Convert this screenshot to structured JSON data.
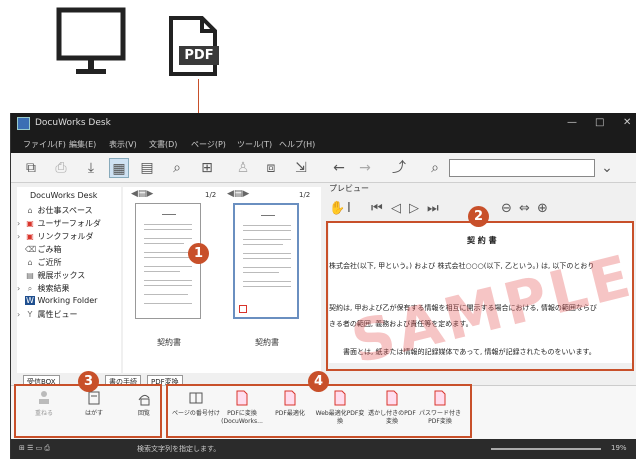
{
  "app": {
    "title": "DocuWorks Desk",
    "menu": [
      "ファイル(F)",
      "編集(E)",
      "表示(V)",
      "文書(D)",
      "ページ(P)",
      "ツール(T)",
      "ヘルプ(H)"
    ]
  },
  "pdf_badge": "PDF",
  "tree": {
    "root": "DocuWorks Desk",
    "items": [
      {
        "label": "お仕事スペース",
        "icon": "workspace-icon",
        "chevron": false
      },
      {
        "label": "ユーザーフォルダ",
        "icon": "user-folder-icon",
        "chevron": true
      },
      {
        "label": "リンクフォルダ",
        "icon": "link-folder-icon",
        "chevron": true
      },
      {
        "label": "ごみ箱",
        "icon": "trash-icon",
        "chevron": false
      },
      {
        "label": "ご近所",
        "icon": "neighborhood-icon",
        "chevron": false
      },
      {
        "label": "親展ボックス",
        "icon": "inbox-icon",
        "chevron": false
      },
      {
        "label": "検索結果",
        "icon": "search-results-icon",
        "chevron": true
      },
      {
        "label": "Working Folder",
        "icon": "working-folder-icon",
        "chevron": false
      },
      {
        "label": "属性ビュー",
        "icon": "attribute-view-icon",
        "chevron": true
      }
    ]
  },
  "thumbnails": [
    {
      "label": "契約書",
      "page": "1/2"
    },
    {
      "label": "契約書",
      "page": "1/2"
    }
  ],
  "preview": {
    "header": "プレビュー",
    "doc_title": "契 約 書",
    "watermark": "SAMPLE",
    "lines": [
      "株式会社(以下, 甲という。) および 株式会社○○○(以下, 乙という。) は, 以下のとおり",
      "契約は, 甲および乙が保有する情報を相互に開示する場合における, 情報の範囲ならび",
      "きる者の範囲, 義務および責任等を定めます。",
      "書面とは, 紙または情報的記録媒体であって, 情報が記録されたものをいいます。"
    ]
  },
  "tabs": [
    "受信BOX",
    "書の手続",
    "PDF変換"
  ],
  "ribbon": {
    "left": [
      {
        "label": "重ねる",
        "icon": "stamp-icon"
      },
      {
        "label": "はがす",
        "icon": "peel-icon"
      },
      {
        "label": "回覧",
        "icon": "circulate-icon"
      }
    ],
    "right": [
      {
        "label": "ページの番号付け",
        "icon": "page-number-icon"
      },
      {
        "label": "PDFに変換(DocuWorks...",
        "icon": "pdf-convert-icon"
      },
      {
        "label": "PDF最適化",
        "icon": "pdf-optimize-icon"
      },
      {
        "label": "Web最適化PDF変換",
        "icon": "pdf-web-icon"
      },
      {
        "label": "透かし付きのPDF変換",
        "icon": "pdf-watermark-icon"
      },
      {
        "label": "パスワード付きPDF変換",
        "icon": "pdf-password-icon"
      }
    ]
  },
  "status": {
    "text": "検索文字列を指定します。",
    "zoom": "19%"
  },
  "callouts": [
    "1",
    "2",
    "3",
    "4"
  ],
  "colors": {
    "callout": "#c8502a",
    "watermark": "#e65a5a",
    "titlebar": "#1b1b1b"
  }
}
